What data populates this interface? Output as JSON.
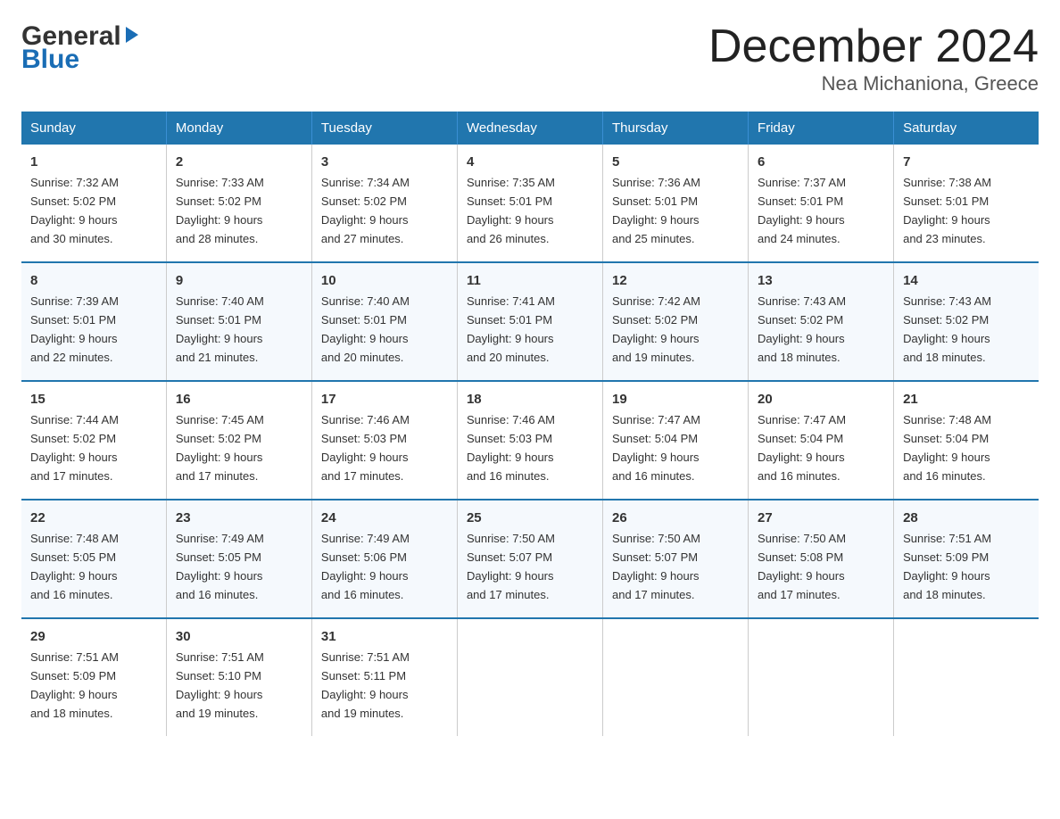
{
  "logo": {
    "line1": "General",
    "arrow": "▶",
    "line2": "Blue"
  },
  "title": "December 2024",
  "subtitle": "Nea Michaniona, Greece",
  "headers": [
    "Sunday",
    "Monday",
    "Tuesday",
    "Wednesday",
    "Thursday",
    "Friday",
    "Saturday"
  ],
  "weeks": [
    [
      {
        "day": "1",
        "sunrise": "7:32 AM",
        "sunset": "5:02 PM",
        "daylight": "9 hours and 30 minutes."
      },
      {
        "day": "2",
        "sunrise": "7:33 AM",
        "sunset": "5:02 PM",
        "daylight": "9 hours and 28 minutes."
      },
      {
        "day": "3",
        "sunrise": "7:34 AM",
        "sunset": "5:02 PM",
        "daylight": "9 hours and 27 minutes."
      },
      {
        "day": "4",
        "sunrise": "7:35 AM",
        "sunset": "5:01 PM",
        "daylight": "9 hours and 26 minutes."
      },
      {
        "day": "5",
        "sunrise": "7:36 AM",
        "sunset": "5:01 PM",
        "daylight": "9 hours and 25 minutes."
      },
      {
        "day": "6",
        "sunrise": "7:37 AM",
        "sunset": "5:01 PM",
        "daylight": "9 hours and 24 minutes."
      },
      {
        "day": "7",
        "sunrise": "7:38 AM",
        "sunset": "5:01 PM",
        "daylight": "9 hours and 23 minutes."
      }
    ],
    [
      {
        "day": "8",
        "sunrise": "7:39 AM",
        "sunset": "5:01 PM",
        "daylight": "9 hours and 22 minutes."
      },
      {
        "day": "9",
        "sunrise": "7:40 AM",
        "sunset": "5:01 PM",
        "daylight": "9 hours and 21 minutes."
      },
      {
        "day": "10",
        "sunrise": "7:40 AM",
        "sunset": "5:01 PM",
        "daylight": "9 hours and 20 minutes."
      },
      {
        "day": "11",
        "sunrise": "7:41 AM",
        "sunset": "5:01 PM",
        "daylight": "9 hours and 20 minutes."
      },
      {
        "day": "12",
        "sunrise": "7:42 AM",
        "sunset": "5:02 PM",
        "daylight": "9 hours and 19 minutes."
      },
      {
        "day": "13",
        "sunrise": "7:43 AM",
        "sunset": "5:02 PM",
        "daylight": "9 hours and 18 minutes."
      },
      {
        "day": "14",
        "sunrise": "7:43 AM",
        "sunset": "5:02 PM",
        "daylight": "9 hours and 18 minutes."
      }
    ],
    [
      {
        "day": "15",
        "sunrise": "7:44 AM",
        "sunset": "5:02 PM",
        "daylight": "9 hours and 17 minutes."
      },
      {
        "day": "16",
        "sunrise": "7:45 AM",
        "sunset": "5:02 PM",
        "daylight": "9 hours and 17 minutes."
      },
      {
        "day": "17",
        "sunrise": "7:46 AM",
        "sunset": "5:03 PM",
        "daylight": "9 hours and 17 minutes."
      },
      {
        "day": "18",
        "sunrise": "7:46 AM",
        "sunset": "5:03 PM",
        "daylight": "9 hours and 16 minutes."
      },
      {
        "day": "19",
        "sunrise": "7:47 AM",
        "sunset": "5:04 PM",
        "daylight": "9 hours and 16 minutes."
      },
      {
        "day": "20",
        "sunrise": "7:47 AM",
        "sunset": "5:04 PM",
        "daylight": "9 hours and 16 minutes."
      },
      {
        "day": "21",
        "sunrise": "7:48 AM",
        "sunset": "5:04 PM",
        "daylight": "9 hours and 16 minutes."
      }
    ],
    [
      {
        "day": "22",
        "sunrise": "7:48 AM",
        "sunset": "5:05 PM",
        "daylight": "9 hours and 16 minutes."
      },
      {
        "day": "23",
        "sunrise": "7:49 AM",
        "sunset": "5:05 PM",
        "daylight": "9 hours and 16 minutes."
      },
      {
        "day": "24",
        "sunrise": "7:49 AM",
        "sunset": "5:06 PM",
        "daylight": "9 hours and 16 minutes."
      },
      {
        "day": "25",
        "sunrise": "7:50 AM",
        "sunset": "5:07 PM",
        "daylight": "9 hours and 17 minutes."
      },
      {
        "day": "26",
        "sunrise": "7:50 AM",
        "sunset": "5:07 PM",
        "daylight": "9 hours and 17 minutes."
      },
      {
        "day": "27",
        "sunrise": "7:50 AM",
        "sunset": "5:08 PM",
        "daylight": "9 hours and 17 minutes."
      },
      {
        "day": "28",
        "sunrise": "7:51 AM",
        "sunset": "5:09 PM",
        "daylight": "9 hours and 18 minutes."
      }
    ],
    [
      {
        "day": "29",
        "sunrise": "7:51 AM",
        "sunset": "5:09 PM",
        "daylight": "9 hours and 18 minutes."
      },
      {
        "day": "30",
        "sunrise": "7:51 AM",
        "sunset": "5:10 PM",
        "daylight": "9 hours and 19 minutes."
      },
      {
        "day": "31",
        "sunrise": "7:51 AM",
        "sunset": "5:11 PM",
        "daylight": "9 hours and 19 minutes."
      },
      null,
      null,
      null,
      null
    ]
  ],
  "labels": {
    "sunrise": "Sunrise:",
    "sunset": "Sunset:",
    "daylight": "Daylight:"
  }
}
